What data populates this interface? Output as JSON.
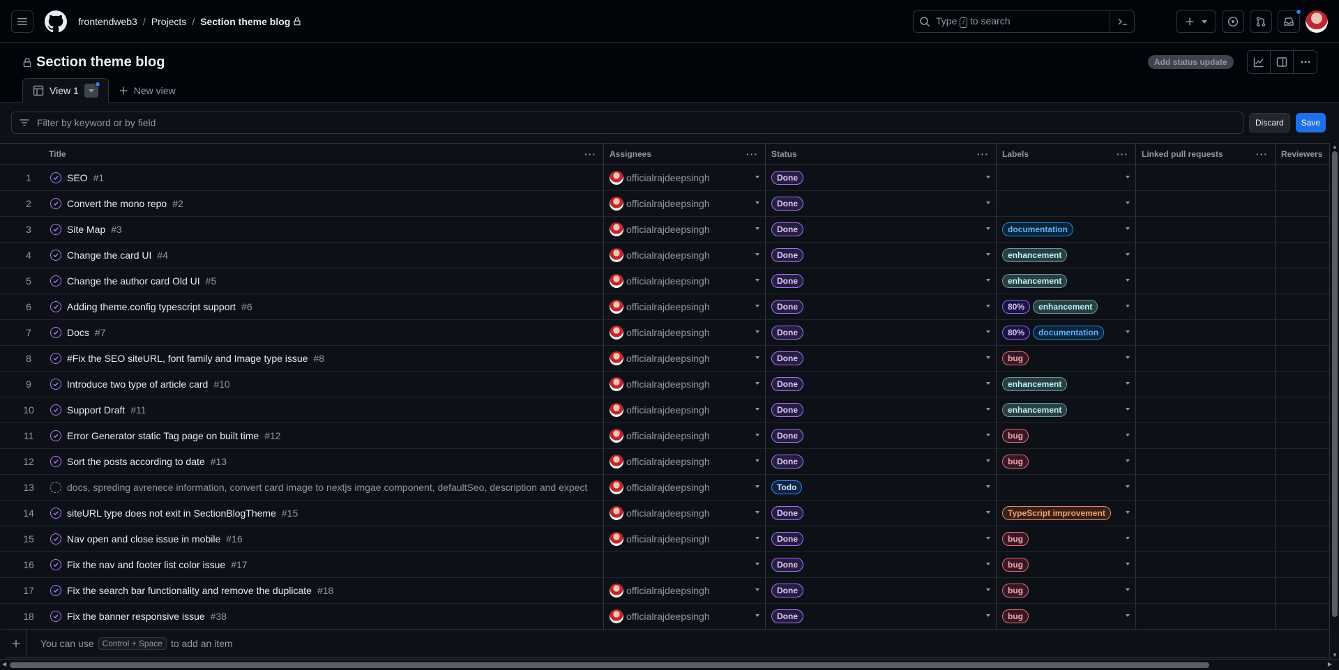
{
  "header": {
    "breadcrumb": {
      "owner": "frontendweb3",
      "section": "Projects",
      "current": "Section theme blog"
    },
    "search": {
      "prefix": "Type",
      "key": "/",
      "suffix": "to search"
    }
  },
  "project": {
    "title": "Section theme blog",
    "status_button": "Add status update",
    "tabs": [
      {
        "label": "View 1"
      },
      {
        "label": "New view"
      }
    ]
  },
  "filter": {
    "placeholder": "Filter by keyword or by field",
    "discard": "Discard",
    "save": "Save"
  },
  "columns": {
    "title": "Title",
    "assignees": "Assignees",
    "status": "Status",
    "labels": "Labels",
    "linked_prs": "Linked pull requests",
    "reviewers": "Reviewers"
  },
  "rows": [
    {
      "n": "1",
      "title": "SEO",
      "num": "#1",
      "assignee": "officialrajdeepsingh",
      "status": "Done",
      "labels": []
    },
    {
      "n": "2",
      "title": "Convert the mono repo",
      "num": "#2",
      "assignee": "officialrajdeepsingh",
      "status": "Done",
      "labels": []
    },
    {
      "n": "3",
      "title": "Site Map",
      "num": "#3",
      "assignee": "officialrajdeepsingh",
      "status": "Done",
      "labels": [
        {
          "text": "documentation",
          "kind": "documentation"
        }
      ]
    },
    {
      "n": "4",
      "title": "Change the card UI",
      "num": "#4",
      "assignee": "officialrajdeepsingh",
      "status": "Done",
      "labels": [
        {
          "text": "enhancement",
          "kind": "enhancement"
        }
      ]
    },
    {
      "n": "5",
      "title": "Change the author card Old UI",
      "num": "#5",
      "assignee": "officialrajdeepsingh",
      "status": "Done",
      "labels": [
        {
          "text": "enhancement",
          "kind": "enhancement"
        }
      ]
    },
    {
      "n": "6",
      "title": "Adding theme.config typescript support",
      "num": "#6",
      "assignee": "officialrajdeepsingh",
      "status": "Done",
      "labels": [
        {
          "text": "80%",
          "kind": "80"
        },
        {
          "text": "enhancement",
          "kind": "enhancement"
        }
      ]
    },
    {
      "n": "7",
      "title": "Docs",
      "num": "#7",
      "assignee": "officialrajdeepsingh",
      "status": "Done",
      "labels": [
        {
          "text": "80%",
          "kind": "80"
        },
        {
          "text": "documentation",
          "kind": "documentation"
        }
      ]
    },
    {
      "n": "8",
      "title": "#Fix the SEO siteURL, font family and Image type issue",
      "num": "#8",
      "assignee": "officialrajdeepsingh",
      "status": "Done",
      "labels": [
        {
          "text": "bug",
          "kind": "bug"
        }
      ]
    },
    {
      "n": "9",
      "title": "Introduce two type of article card",
      "num": "#10",
      "assignee": "officialrajdeepsingh",
      "status": "Done",
      "labels": [
        {
          "text": "enhancement",
          "kind": "enhancement"
        }
      ]
    },
    {
      "n": "10",
      "title": "Support Draft",
      "num": "#11",
      "assignee": "officialrajdeepsingh",
      "status": "Done",
      "labels": [
        {
          "text": "enhancement",
          "kind": "enhancement"
        }
      ]
    },
    {
      "n": "11",
      "title": "Error Generator static Tag page on built time",
      "num": "#12",
      "assignee": "officialrajdeepsingh",
      "status": "Done",
      "labels": [
        {
          "text": "bug",
          "kind": "bug"
        }
      ]
    },
    {
      "n": "12",
      "title": "Sort the posts according to date",
      "num": "#13",
      "assignee": "officialrajdeepsingh",
      "status": "Done",
      "labels": [
        {
          "text": "bug",
          "kind": "bug"
        }
      ]
    },
    {
      "n": "13",
      "title": "docs, spreding avrenece information, convert card image to nextjs imgae component, defaultSeo, description and expect",
      "num": "",
      "assignee": "officialrajdeepsingh",
      "status": "Todo",
      "draft": true,
      "labels": []
    },
    {
      "n": "14",
      "title": "siteURL type does not exit in SectionBlogTheme",
      "num": "#15",
      "assignee": "officialrajdeepsingh",
      "status": "Done",
      "labels": [
        {
          "text": "TypeScript improvement",
          "kind": "ts"
        }
      ]
    },
    {
      "n": "15",
      "title": "Nav open and close issue in mobile",
      "num": "#16",
      "assignee": "officialrajdeepsingh",
      "status": "Done",
      "labels": [
        {
          "text": "bug",
          "kind": "bug"
        }
      ]
    },
    {
      "n": "16",
      "title": "Fix the nav and footer list color issue",
      "num": "#17",
      "assignee": "",
      "status": "Done",
      "labels": [
        {
          "text": "bug",
          "kind": "bug"
        }
      ]
    },
    {
      "n": "17",
      "title": "Fix the search bar functionality and remove the duplicate",
      "num": "#18",
      "assignee": "officialrajdeepsingh",
      "status": "Done",
      "labels": [
        {
          "text": "bug",
          "kind": "bug"
        }
      ]
    },
    {
      "n": "18",
      "title": "Fix the banner responsive issue",
      "num": "#38",
      "assignee": "officialrajdeepsingh",
      "status": "Done",
      "labels": [
        {
          "text": "bug",
          "kind": "bug"
        }
      ]
    }
  ],
  "add_item": {
    "prefix": "You can use",
    "shortcut": "Control + Space",
    "suffix": "to add an item"
  }
}
